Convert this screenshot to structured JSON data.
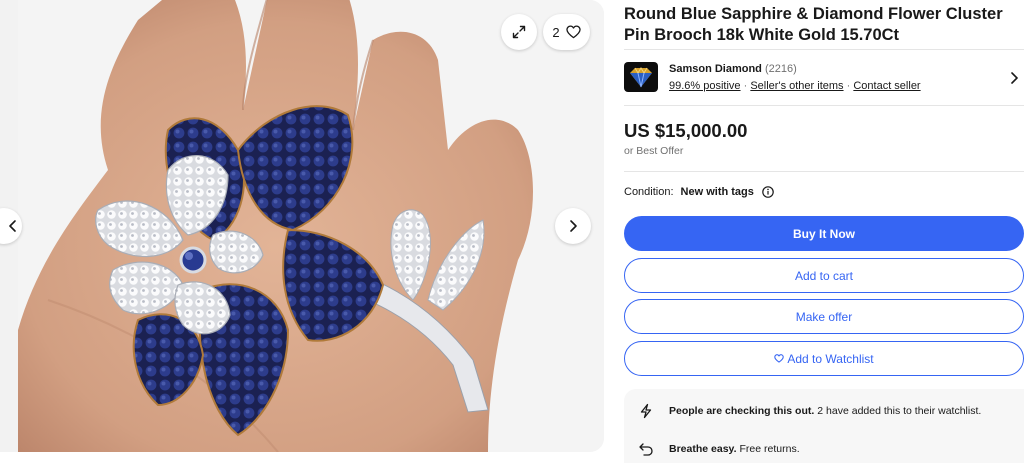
{
  "gallery": {
    "watch_count": "2",
    "image_alt": "Round Blue Sapphire & Diamond Flower Cluster Pin Brooch on palm"
  },
  "item": {
    "title": "Round Blue Sapphire & Diamond Flower Cluster Pin Brooch 18k White Gold 15.70Ct",
    "price": "US $15,000.00",
    "best_offer": "or Best Offer",
    "condition_label": "Condition:",
    "condition_value": "New with tags"
  },
  "seller": {
    "name": "Samson Diamond",
    "feedback_count": "(2216)",
    "positive": "99.6% positive",
    "sep": "·",
    "other_items": "Seller's other items",
    "contact": "Contact seller"
  },
  "actions": {
    "buy_now": "Buy It Now",
    "add_to_cart": "Add to cart",
    "make_offer": "Make offer",
    "add_to_watchlist": "Add to Watchlist"
  },
  "notes": {
    "checking_bold": "People are checking this out.",
    "checking_text": "2 have added this to their watchlist.",
    "returns_bold": "Breathe easy.",
    "returns_text": "Free returns."
  },
  "colors": {
    "primary": "#3665f3",
    "text": "#191919",
    "muted": "#707070",
    "sapphire": "#1f2a6b",
    "gold": "#b07a3a"
  },
  "icons": [
    "expand-icon",
    "heart-icon",
    "chevron-left-icon",
    "chevron-right-icon",
    "info-icon",
    "lightning-icon",
    "return-arrow-icon"
  ]
}
